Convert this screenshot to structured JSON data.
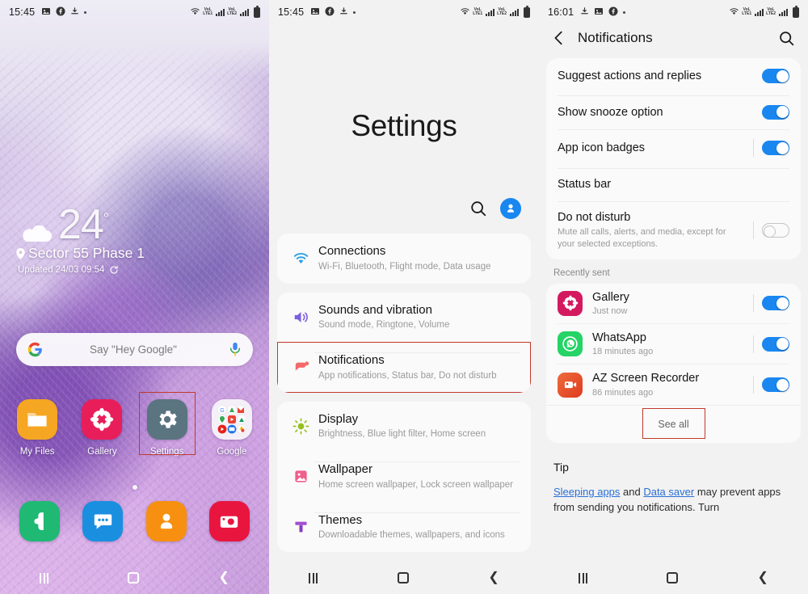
{
  "panel1": {
    "status": {
      "time": "15:45",
      "icons": [
        "photos-icon",
        "facebook-icon",
        "download-icon",
        "dot-icon"
      ],
      "right_icons": [
        "wifi-icon",
        "volte-lte1-icon",
        "volte-lte2-icon",
        "battery-icon"
      ],
      "volte_label": "VoLTE",
      "lte1_label": "LTE1",
      "lte2_label": "LTE2"
    },
    "weather": {
      "temp": "24",
      "degree": "°",
      "location": "Sector 55 Phase 1",
      "updated": "Updated 24/03 09:54"
    },
    "search": {
      "placeholder": "Say \"Hey Google\"",
      "logo": "google-logo-icon",
      "mic": "microphone-icon"
    },
    "apps": [
      {
        "label": "My Files",
        "icon": "my-files-icon",
        "color": "#f5a623",
        "highlighted": false
      },
      {
        "label": "Gallery",
        "icon": "gallery-icon",
        "color": "#e81e5a",
        "highlighted": false
      },
      {
        "label": "Settings",
        "icon": "settings-gear-icon",
        "color": "#5a7480",
        "highlighted": true
      },
      {
        "label": "Google",
        "icon": "google-folder-icon",
        "color": "#f2eef6",
        "highlighted": false
      }
    ],
    "dock": [
      {
        "label": "Phone",
        "icon": "phone-icon",
        "color": "#1fb974"
      },
      {
        "label": "Messages",
        "icon": "messages-icon",
        "color": "#1a8fe0"
      },
      {
        "label": "Contacts",
        "icon": "contacts-icon",
        "color": "#f79010"
      },
      {
        "label": "Camera",
        "icon": "camera-icon",
        "color": "#e8153f"
      }
    ],
    "page_dots": 1,
    "nav": {
      "recent": "recent-apps-icon",
      "home": "home-icon",
      "back": "back-icon"
    }
  },
  "panel2": {
    "status": {
      "time": "15:45"
    },
    "title": "Settings",
    "tools": {
      "search": "search-icon",
      "account": "account-avatar-icon"
    },
    "groups": [
      {
        "items": [
          {
            "title": "Connections",
            "subtitle": "Wi-Fi, Bluetooth, Flight mode, Data usage",
            "icon": "wifi-icon",
            "color": "#2f9fe8",
            "highlighted": false
          }
        ]
      },
      {
        "items": [
          {
            "title": "Sounds and vibration",
            "subtitle": "Sound mode, Ringtone, Volume",
            "icon": "speaker-icon",
            "color": "#7c5fe0",
            "highlighted": false
          },
          {
            "title": "Notifications",
            "subtitle": "App notifications, Status bar, Do not disturb",
            "icon": "notification-bubble-icon",
            "color": "#f4696b",
            "highlighted": true
          }
        ]
      },
      {
        "items": [
          {
            "title": "Display",
            "subtitle": "Brightness, Blue light filter, Home screen",
            "icon": "brightness-icon",
            "color": "#95c11f",
            "highlighted": false
          },
          {
            "title": "Wallpaper",
            "subtitle": "Home screen wallpaper, Lock screen wallpaper",
            "icon": "wallpaper-icon",
            "color": "#ef5f8b",
            "highlighted": false
          },
          {
            "title": "Themes",
            "subtitle": "Downloadable themes, wallpapers, and icons",
            "icon": "themes-icon",
            "color": "#a24fd0",
            "highlighted": false
          }
        ]
      }
    ]
  },
  "panel3": {
    "status": {
      "time": "16:01"
    },
    "appbar": {
      "back": "back-arrow-icon",
      "title": "Notifications",
      "search": "search-icon"
    },
    "settings_rows": [
      {
        "label": "Suggest actions and replies",
        "toggle": "on",
        "divider": false
      },
      {
        "label": "Show snooze option",
        "toggle": "on",
        "divider": false
      },
      {
        "label": "App icon badges",
        "toggle": "on",
        "divider": true
      },
      {
        "label": "Status bar",
        "toggle": null,
        "divider": false
      },
      {
        "label": "Do not disturb",
        "sub": "Mute all calls, alerts, and media, except for your selected exceptions.",
        "toggle": "off",
        "divider": true
      }
    ],
    "recently_sent_header": "Recently sent",
    "recent_apps": [
      {
        "name": "Gallery",
        "time": "Just now",
        "icon": "gallery-icon",
        "color": "#d41a5f",
        "toggle": "on"
      },
      {
        "name": "WhatsApp",
        "time": "18 minutes ago",
        "icon": "whatsapp-icon",
        "color": "#25d366",
        "toggle": "on"
      },
      {
        "name": "AZ Screen Recorder",
        "time": "86 minutes ago",
        "icon": "az-screen-recorder-icon",
        "color": "#e8502a",
        "toggle": "on"
      }
    ],
    "see_all": "See all",
    "tip": {
      "heading": "Tip",
      "link1": "Sleeping apps",
      "mid": " and ",
      "link2": "Data saver",
      "rest": " may prevent apps from sending you notifications. Turn"
    }
  },
  "colors": {
    "accent": "#1a87f0",
    "highlight": "#c0392b",
    "card": "#fafafa",
    "bg": "#f2f2f2"
  }
}
